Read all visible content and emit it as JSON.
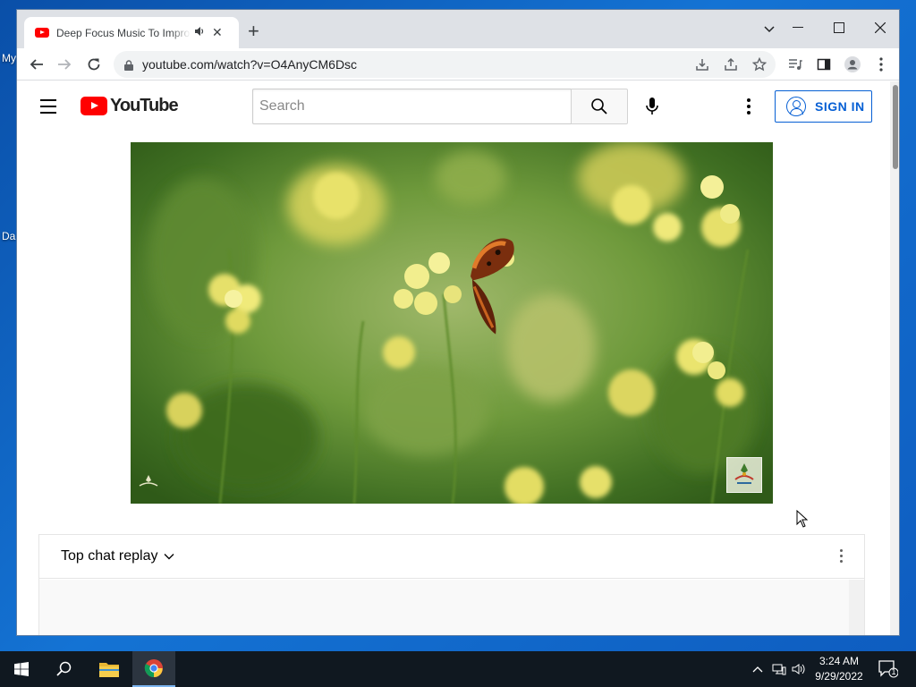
{
  "desktop": {
    "icon_label_1": "My",
    "icon_label_2": "Da"
  },
  "browser": {
    "tab": {
      "title": "Deep Focus Music To Improve",
      "audio_icon": "speaker-icon",
      "close_glyph": "✕"
    },
    "new_tab_glyph": "+",
    "window_controls": {
      "minimize": "—",
      "maximize": "☐",
      "close": "✕"
    },
    "address_bar": {
      "url": "youtube.com/watch?v=O4AnyCM6Dsc"
    }
  },
  "youtube": {
    "logo_text": "YouTube",
    "search": {
      "placeholder": "Search",
      "value": ""
    },
    "sign_in_label": "SIGN IN",
    "chat": {
      "title": "Top chat replay"
    }
  },
  "taskbar": {
    "clock_time": "3:24 AM",
    "clock_date": "9/29/2022",
    "notification_count": "1"
  },
  "colors": {
    "youtube_red": "#ff0000",
    "sign_in_blue": "#065fd4",
    "taskbar": "#101820",
    "desktop": "#1473d4"
  }
}
